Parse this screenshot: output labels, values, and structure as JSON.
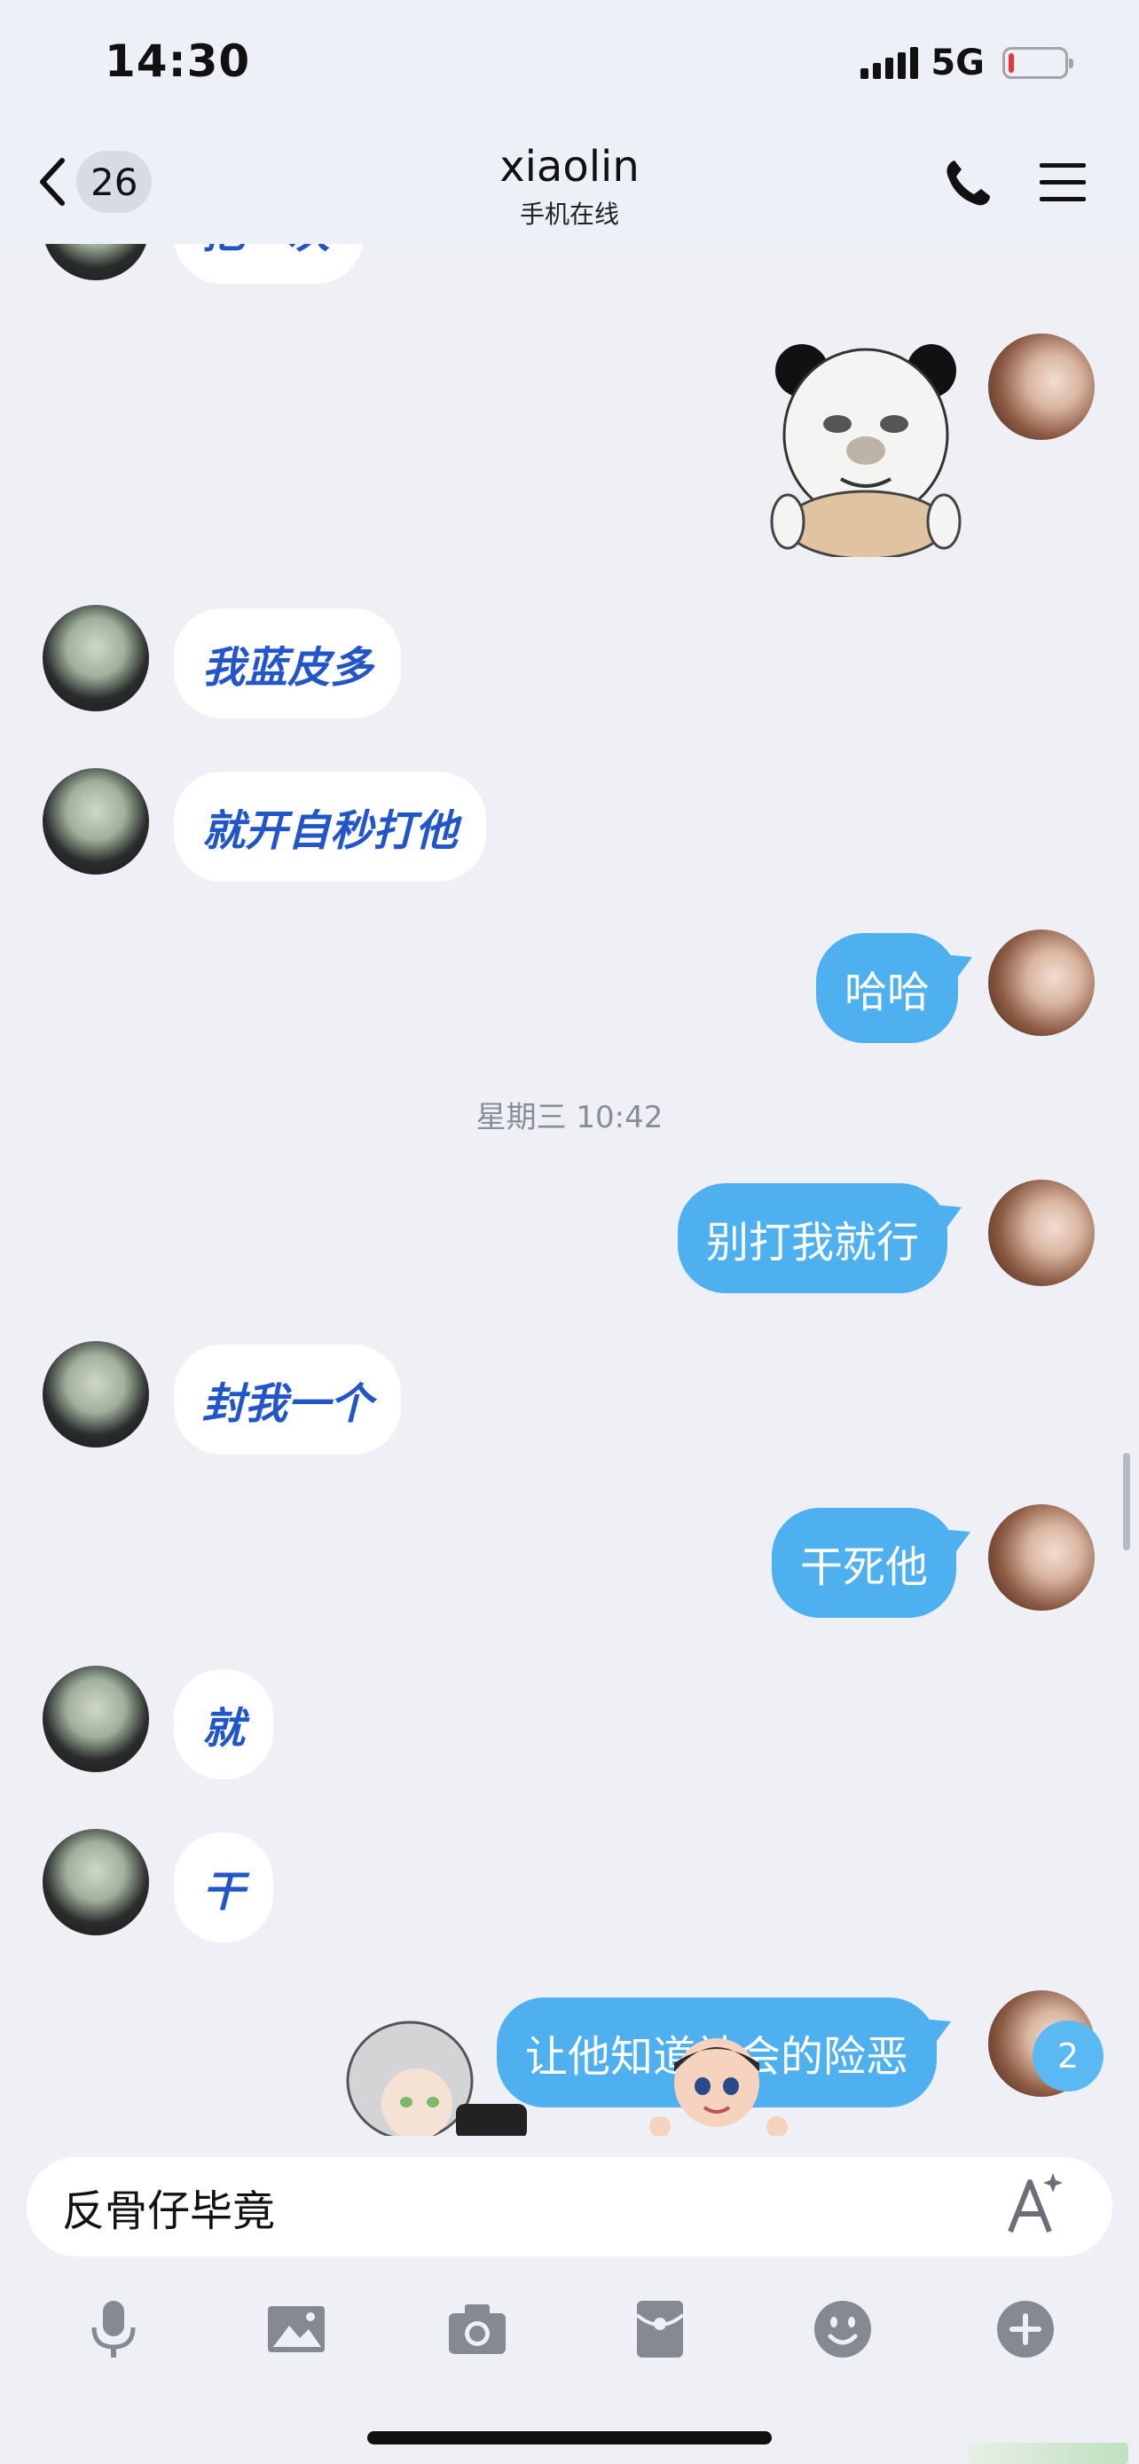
{
  "status": {
    "time": "14:30",
    "network": "5G"
  },
  "header": {
    "back_count": "26",
    "title": "xiaolin",
    "subtitle": "手机在线"
  },
  "messages": [
    {
      "from": "friend",
      "text": "把一次"
    },
    {
      "from": "self",
      "type": "sticker",
      "sticker": "panda-meme"
    },
    {
      "from": "friend",
      "text": "我蓝皮多"
    },
    {
      "from": "friend",
      "text": "就开自秒打他"
    },
    {
      "from": "self",
      "text": "哈哈"
    },
    {
      "from": "self",
      "text": "别打我就行"
    },
    {
      "from": "friend",
      "text": "封我一个"
    },
    {
      "from": "self",
      "text": "干死他"
    },
    {
      "from": "friend",
      "text": "就"
    },
    {
      "from": "friend",
      "text": "干"
    },
    {
      "from": "self",
      "text": "让他知道社会的险恶"
    }
  ],
  "timestamp": "星期三 10:42",
  "new_badge": "2",
  "composer": {
    "input_value": "反骨仔毕竟"
  },
  "toolbar": {
    "icons": [
      "microphone-icon",
      "image-icon",
      "camera-icon",
      "red-packet-icon",
      "emoji-icon",
      "plus-icon"
    ]
  },
  "colors": {
    "outgoing": "#4fb0f0",
    "incoming_text": "#2155c8",
    "background": "#eef0f6"
  }
}
